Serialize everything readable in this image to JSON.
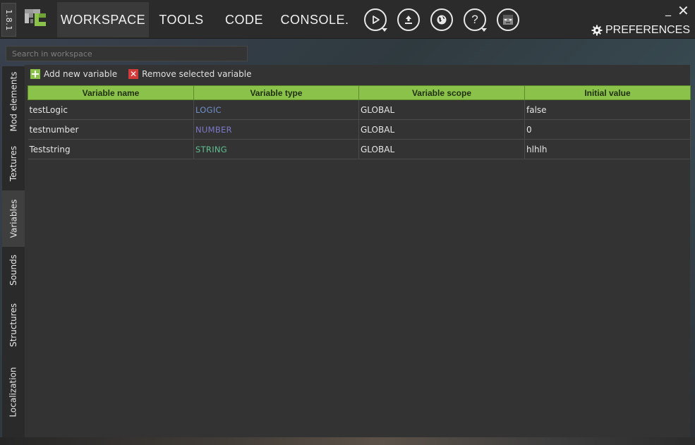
{
  "app": {
    "version": "1.8.1"
  },
  "nav": {
    "tabs": [
      {
        "label": "WORKSPACE",
        "active": true
      },
      {
        "label": "TOOLS",
        "active": false
      },
      {
        "label": "CODE",
        "active": false
      },
      {
        "label": "CONSOLE.",
        "active": false
      }
    ],
    "icon_buttons": [
      {
        "icon": "run-icon",
        "has_dropdown": true
      },
      {
        "icon": "export-icon",
        "has_dropdown": false
      },
      {
        "icon": "globe-icon",
        "has_dropdown": false
      },
      {
        "icon": "help-icon",
        "has_dropdown": true
      },
      {
        "icon": "account-icon",
        "has_dropdown": false
      }
    ],
    "preferences_label": "PREFERENCES"
  },
  "window": {
    "minimize": "_",
    "close": "✕"
  },
  "search": {
    "placeholder": "Search in workspace"
  },
  "sidebar": {
    "tabs": [
      {
        "label": "Mod elements",
        "active": false
      },
      {
        "label": "Textures",
        "active": false
      },
      {
        "label": "Variables",
        "active": true
      },
      {
        "label": "Sounds",
        "active": false
      },
      {
        "label": "Structures",
        "active": false
      },
      {
        "label": "Localization",
        "active": false
      }
    ]
  },
  "toolbar": {
    "add_label": "Add new variable",
    "remove_label": "Remove selected variable"
  },
  "table": {
    "columns": [
      "Variable name",
      "Variable type",
      "Variable scope",
      "Initial value"
    ],
    "rows": [
      {
        "name": "testLogic",
        "type": "LOGIC",
        "scope": "GLOBAL",
        "value": "false"
      },
      {
        "name": "testnumber",
        "type": "NUMBER",
        "scope": "GLOBAL",
        "value": "0"
      },
      {
        "name": "Teststring",
        "type": "STRING",
        "scope": "GLOBAL",
        "value": "hlhlh"
      }
    ]
  },
  "colors": {
    "accent_green": "#8bc34a",
    "type_logic": "#6f8fc9",
    "type_number": "#7b78c8",
    "type_string": "#5fbf8f",
    "remove_red": "#d33b3b"
  }
}
